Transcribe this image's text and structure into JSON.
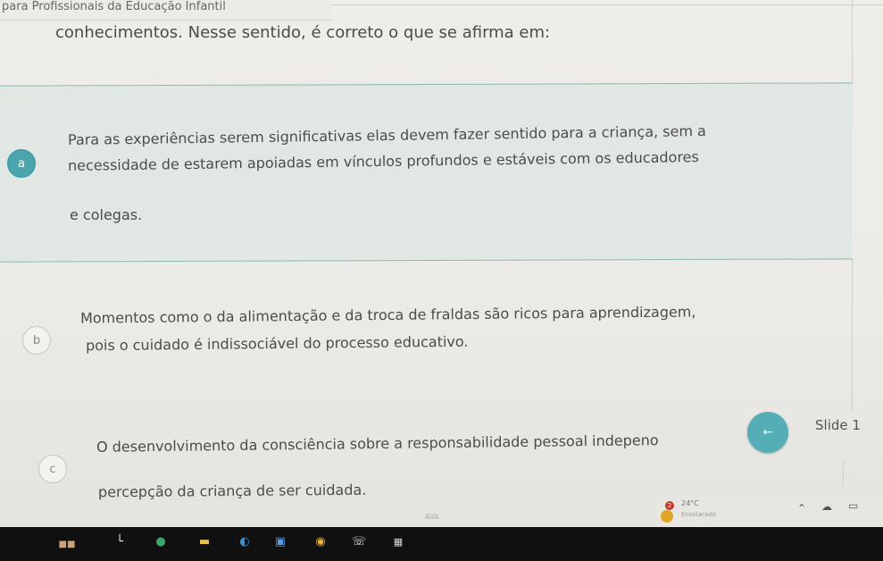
{
  "header": {
    "title": "para Profissionais da Educação Infantil"
  },
  "question": {
    "text": "conhecimentos. Nesse sentido, é correto o que se afirma em:"
  },
  "options": [
    {
      "letter": "a",
      "lines": [
        "Para as experiências serem significativas elas devem fazer sentido para a criança, sem a",
        "necessidade de estarem apoiadas em vínculos profundos e estáveis com os educadores",
        "e colegas."
      ],
      "selected": true
    },
    {
      "letter": "b",
      "lines": [
        "Momentos como o da alimentação e da troca de fraldas são ricos para aprendizagem,",
        "pois o cuidado é indissociável do processo educativo."
      ],
      "selected": false
    },
    {
      "letter": "c",
      "lines": [
        "O desenvolvimento da consciência sobre a responsabilidade pessoal indepeno",
        "percepção da criança de ser cuidada."
      ],
      "selected": false
    }
  ],
  "navigation": {
    "prev_icon": "arrow-left-icon",
    "slide_label": "Slide 1"
  },
  "system_tray": {
    "temperature": "24°C",
    "condition": "Ensolarado",
    "notification_count": "2"
  },
  "taskbar": {
    "ava_label": "AVA",
    "icons": [
      "start-icon",
      "file-icon",
      "app-icon",
      "folder-icon",
      "edge-icon",
      "store-icon",
      "chrome-icon",
      "whatsapp-icon",
      "lr-icon",
      "ava-icon"
    ]
  },
  "colors": {
    "accent": "#4aa5ad",
    "selected_bg": "#e1e8e4",
    "taskbar": "#101010"
  }
}
